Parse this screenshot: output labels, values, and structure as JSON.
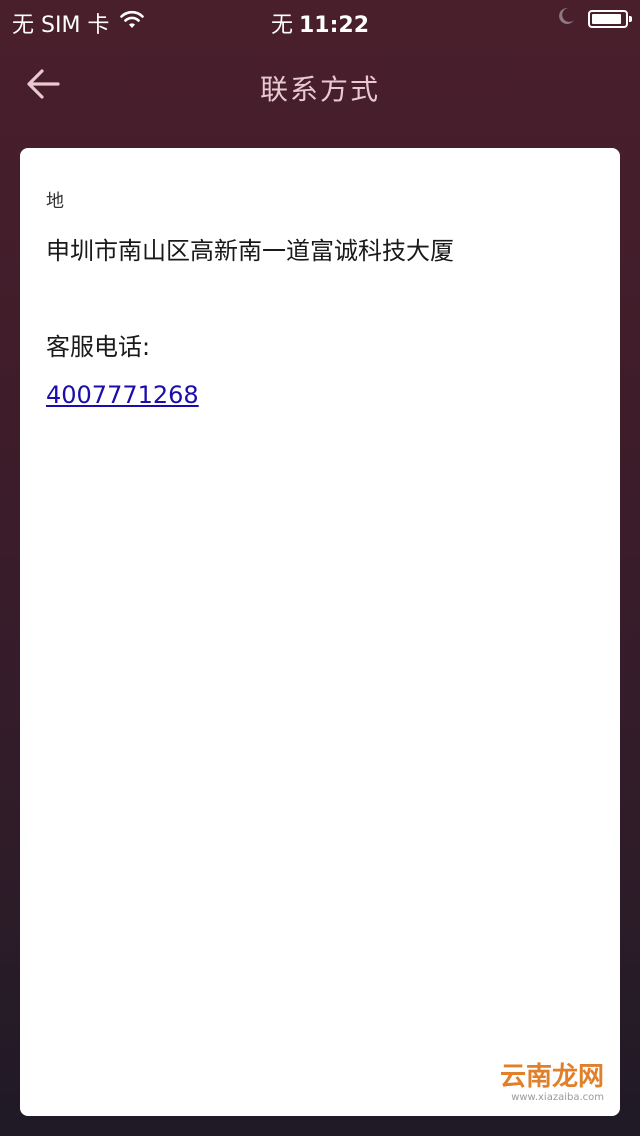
{
  "status_bar": {
    "carrier": "无 SIM 卡",
    "carrier_center": "无",
    "time": "11:22"
  },
  "nav": {
    "title": "联系方式"
  },
  "contact": {
    "address_label": "地",
    "address": "申圳市南山区高新南一道富诚科技大厦",
    "phone_label": "客服电话:",
    "phone": "4007771268"
  },
  "watermark": {
    "main": "云南龙网",
    "sub": "www.xiazaiba.com"
  },
  "colors": {
    "title": "#e8c9d2",
    "link": "#1a0dab",
    "watermark": "#e0802a"
  },
  "icons": {
    "back": "arrow-left",
    "wifi": "wifi",
    "moon": "moon",
    "battery": "battery"
  },
  "battery_level": 0.9
}
